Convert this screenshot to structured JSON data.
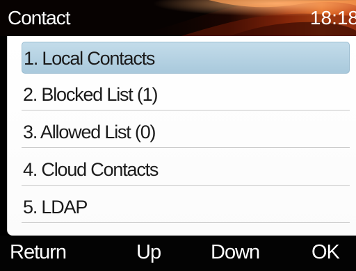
{
  "header": {
    "title": "Contact",
    "time": "18:18"
  },
  "menu": {
    "items": [
      {
        "label": "1. Local Contacts",
        "selected": true
      },
      {
        "label": "2. Blocked List (1)",
        "selected": false
      },
      {
        "label": "3. Allowed List (0)",
        "selected": false
      },
      {
        "label": "4. Cloud Contacts",
        "selected": false
      },
      {
        "label": "5. LDAP",
        "selected": false
      }
    ]
  },
  "softkeys": [
    "Return",
    "Up",
    "Down",
    "OK"
  ],
  "colors": {
    "titlebar_bg": "#070201",
    "flame_accent": "#e0601a",
    "selection": "#b7d3e4",
    "softkey_bg": "#030303",
    "text_dark": "#1b1b1b",
    "text_light": "#ffffff"
  }
}
